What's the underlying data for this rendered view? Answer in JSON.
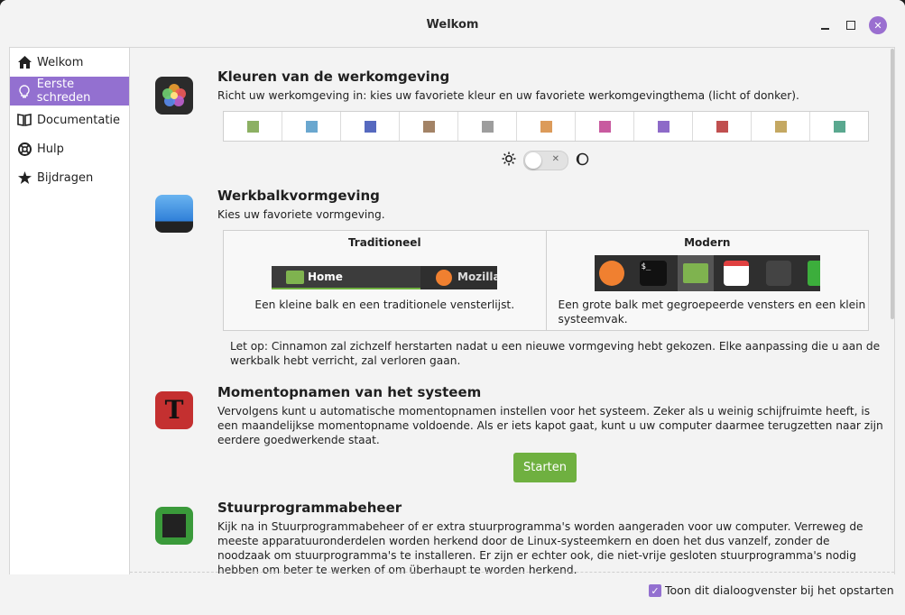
{
  "window": {
    "title": "Welkom"
  },
  "sidebar": {
    "items": [
      {
        "label": "Welkom",
        "icon": "home-icon"
      },
      {
        "label": "Eerste schreden",
        "icon": "lightbulb-icon",
        "active": true
      },
      {
        "label": "Documentatie",
        "icon": "book-icon"
      },
      {
        "label": "Hulp",
        "icon": "lifebuoy-icon"
      },
      {
        "label": "Bijdragen",
        "icon": "star-icon"
      }
    ]
  },
  "sections": {
    "colors": {
      "title": "Kleuren van de werkomgeving",
      "desc": "Richt uw werkomgeving in: kies uw favoriete kleur en uw favoriete werkomgevingthema (licht of donker).",
      "swatches": [
        "#8cb063",
        "#6aa7cf",
        "#5669bf",
        "#a38366",
        "#9d9d9d",
        "#dc9b5a",
        "#c85a9f",
        "#8d6ac8",
        "#c05050",
        "#c4a862",
        "#5aa88f"
      ]
    },
    "panel": {
      "title": "Werkbalkvormgeving",
      "desc": "Kies uw favoriete vormgeving.",
      "traditional": {
        "title": "Traditioneel",
        "bar_home": "Home",
        "bar_app": "Mozilla",
        "desc": "Een kleine balk en een traditionele vensterlijst."
      },
      "modern": {
        "title": "Modern",
        "desc_line1": "Een grote balk met gegroepeerde vensters en een klein",
        "desc_line2": "systeemvak."
      },
      "note_line1": "Let op: Cinnamon zal zichzelf herstarten nadat u een nieuwe vormgeving hebt gekozen. Elke aanpassing die u aan de",
      "note_line2": "werkbalk hebt verricht, zal verloren gaan."
    },
    "snapshots": {
      "title": "Momentopnamen van het systeem",
      "line1": "Vervolgens kunt u automatische momentopnamen instellen voor het systeem. Zeker als u weinig schijfruimte heeft, is",
      "line2": "een maandelijkse momentopname voldoende. Als er iets kapot gaat, kunt u uw computer daarmee terugzetten naar zijn",
      "line3": "eerdere goedwerkende staat.",
      "button": "Starten"
    },
    "drivers": {
      "title": "Stuurprogrammabeheer",
      "line1": "Kijk na in Stuurprogrammabeheer of er extra stuurprogramma's worden aangeraden voor uw computer. Verreweg de",
      "line2": "meeste apparatuuronderdelen worden herkend door de Linux-systeemkern en doen het dus vanzelf, zonder de",
      "line3": "noodzaak om stuurprogramma's te installeren. Er zijn er echter ook, die niet-vrije gesloten stuurprogramma's nodig",
      "line4": "hebben om beter te werken of om überhaupt te worden herkend."
    }
  },
  "footer": {
    "checkbox_label": "Toon dit dialoogvenster bij het opstarten",
    "checked": true
  },
  "theme": {
    "accent": "#9370d0",
    "button_green": "#6fb040"
  }
}
